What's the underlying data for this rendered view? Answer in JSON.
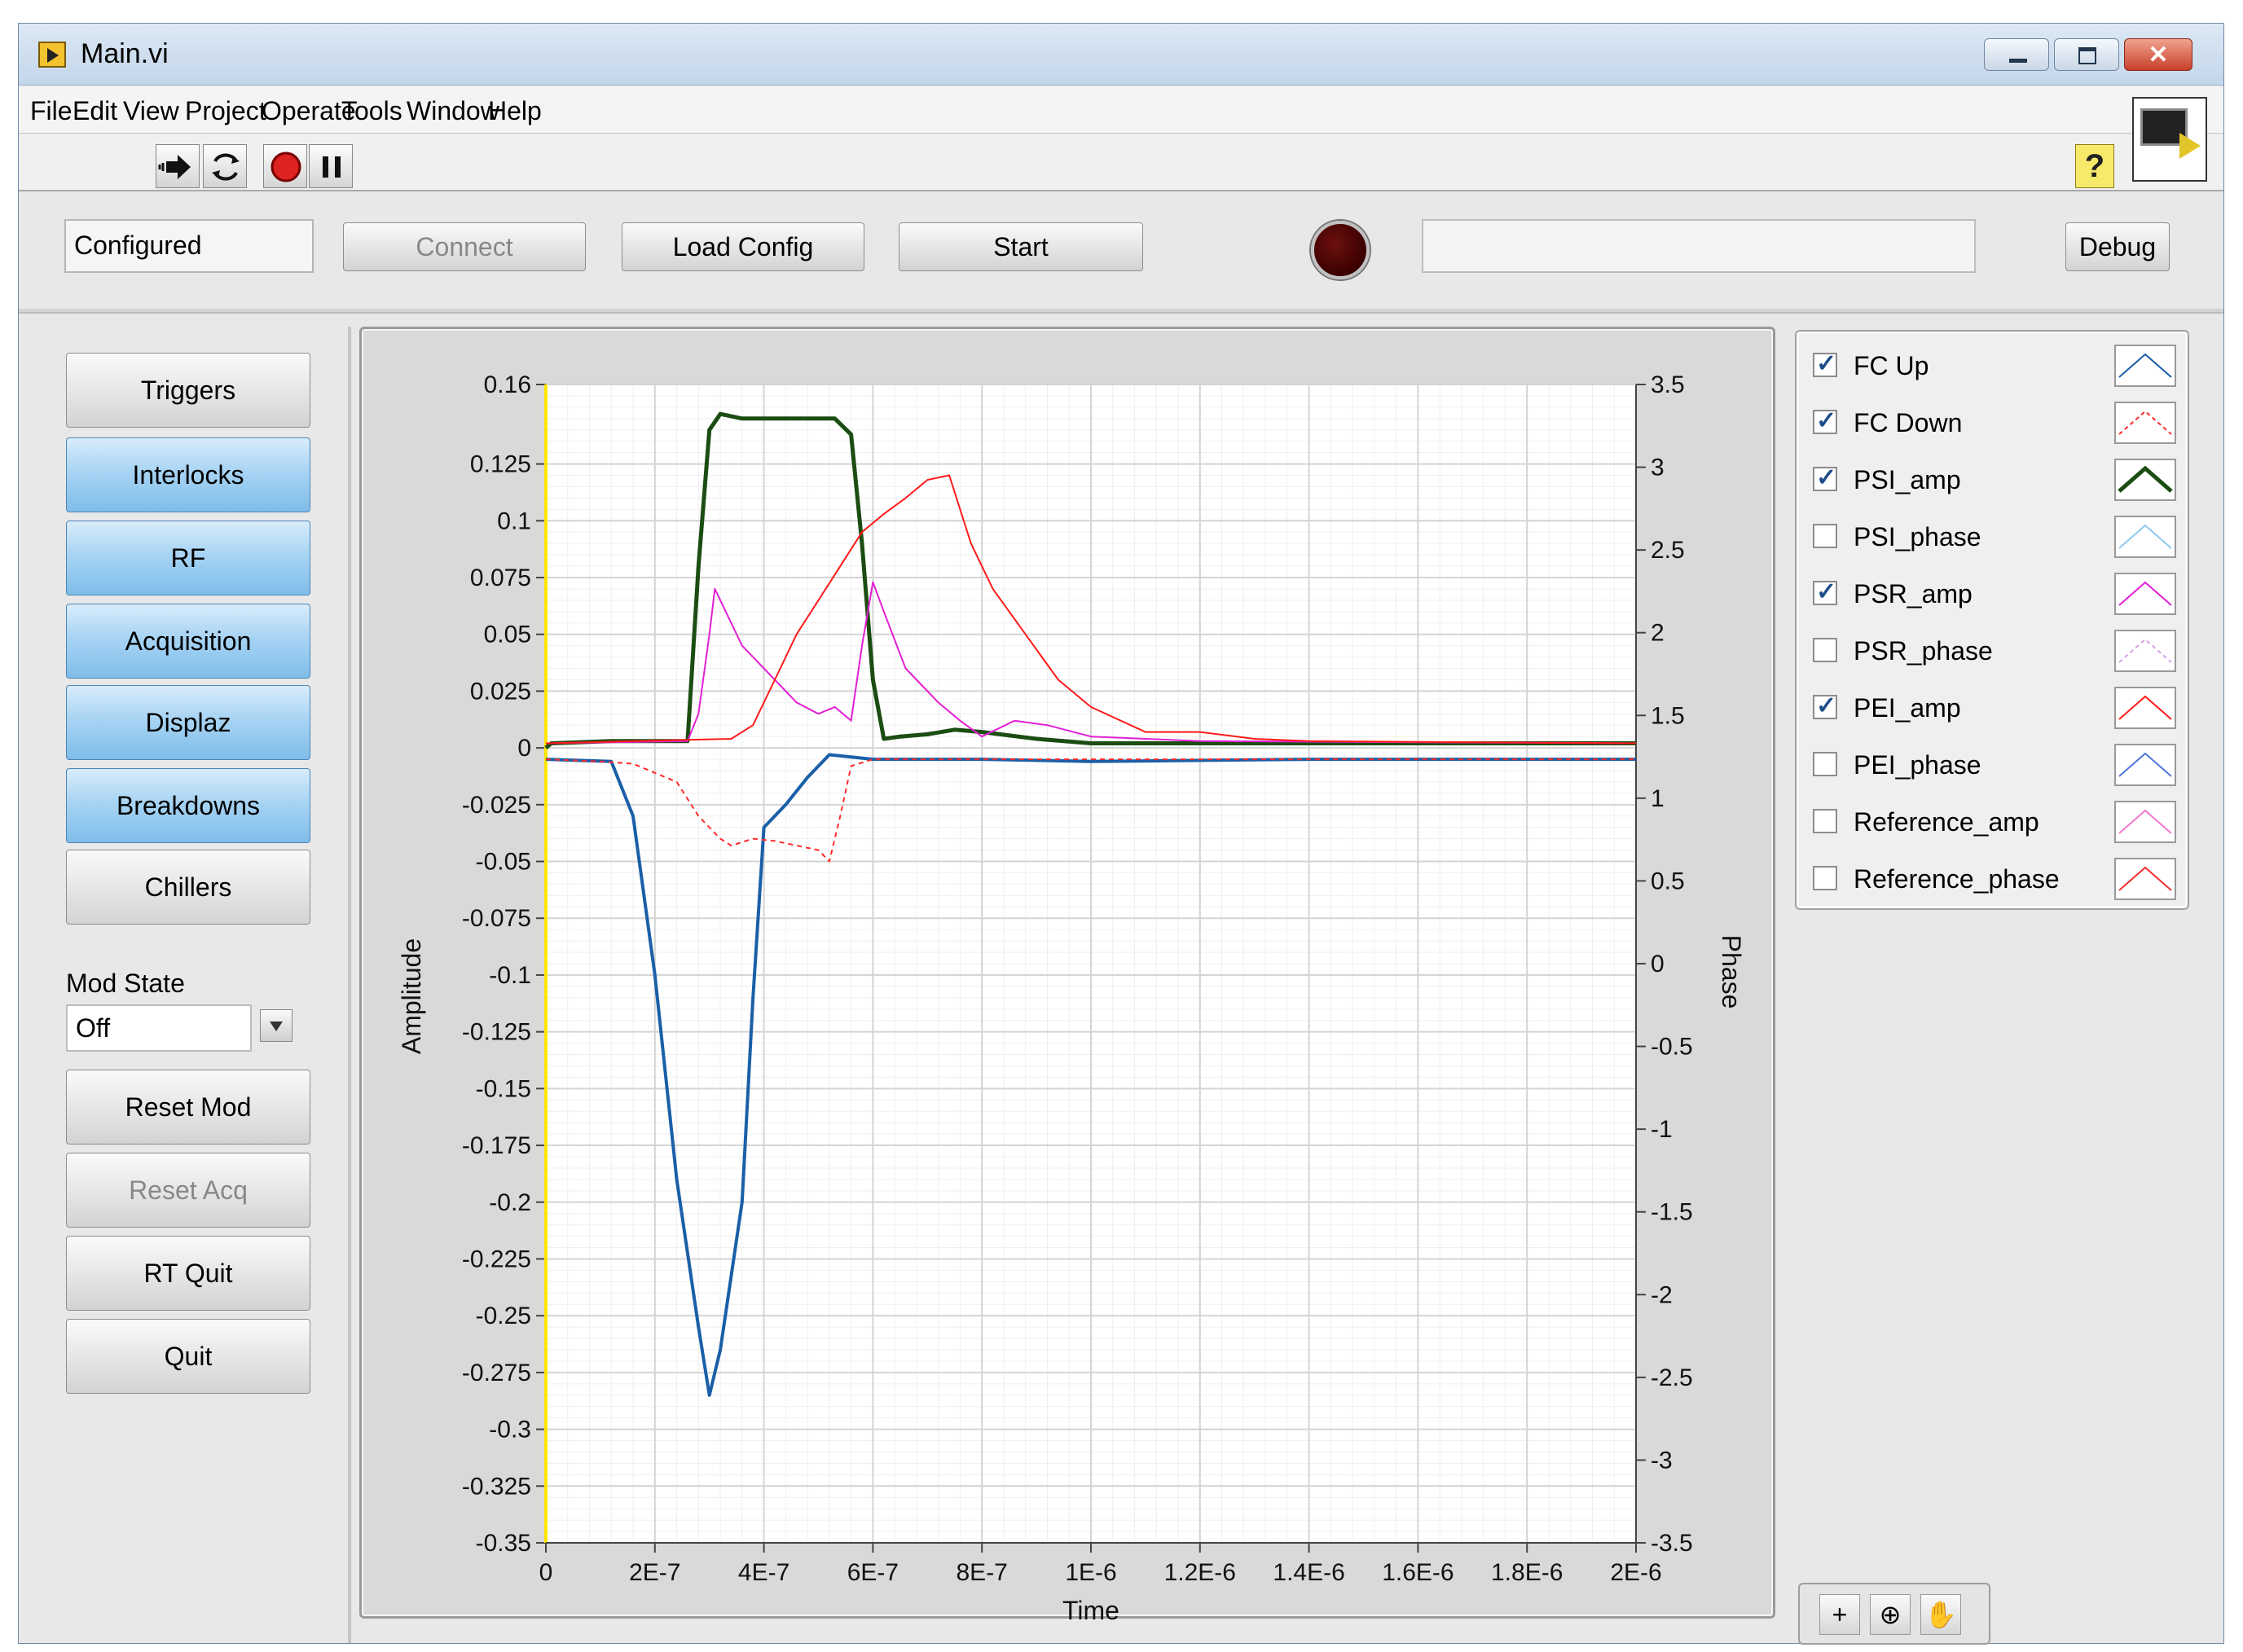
{
  "window": {
    "title": "Main.vi"
  },
  "menubar": {
    "items": [
      "File",
      "Edit",
      "View",
      "Project",
      "Operate",
      "Tools",
      "Window",
      "Help"
    ]
  },
  "toolbar": {
    "run_icon": "run-arrow-icon",
    "run_continuous_icon": "run-continuously-icon",
    "abort_icon": "abort-icon",
    "pause_icon": "pause-icon",
    "help_label": "?"
  },
  "controls": {
    "status_value": "Configured",
    "connect_label": "Connect",
    "load_config_label": "Load Config",
    "start_label": "Start",
    "message_value": "",
    "debug_label": "Debug",
    "led_color": "#3a0000"
  },
  "sidebar": {
    "buttons": [
      {
        "label": "Triggers",
        "style": "gray"
      },
      {
        "label": "Interlocks",
        "style": "blue"
      },
      {
        "label": "RF",
        "style": "blue"
      },
      {
        "label": "Acquisition",
        "style": "blue"
      },
      {
        "label": "Displaz",
        "style": "blue"
      },
      {
        "label": "Breakdowns",
        "style": "blue"
      },
      {
        "label": "Chillers",
        "style": "gray"
      }
    ],
    "mod_state": {
      "label": "Mod State",
      "value": "Off"
    },
    "bottom_buttons": [
      {
        "label": "Reset Mod",
        "disabled": false
      },
      {
        "label": "Reset Acq",
        "disabled": true
      },
      {
        "label": "RT Quit",
        "disabled": false
      },
      {
        "label": "Quit",
        "disabled": false
      }
    ]
  },
  "legend": {
    "items": [
      {
        "name": "FC Up",
        "checked": true,
        "color": "#1a5fa8",
        "dash": false,
        "thick": false
      },
      {
        "name": "FC Down",
        "checked": true,
        "color": "#ff2a2a",
        "dash": true,
        "thick": false
      },
      {
        "name": "PSI_amp",
        "checked": true,
        "color": "#1b4d12",
        "dash": false,
        "thick": true
      },
      {
        "name": "PSI_phase",
        "checked": false,
        "color": "#8fc8ee",
        "dash": false,
        "thick": false
      },
      {
        "name": "PSR_amp",
        "checked": true,
        "color": "#e21fd4",
        "dash": false,
        "thick": false
      },
      {
        "name": "PSR_phase",
        "checked": false,
        "color": "#d6a0e8",
        "dash": true,
        "thick": false
      },
      {
        "name": "PEI_amp",
        "checked": true,
        "color": "#ff1a1a",
        "dash": false,
        "thick": false
      },
      {
        "name": "PEI_phase",
        "checked": false,
        "color": "#4e76d8",
        "dash": false,
        "thick": false
      },
      {
        "name": "Reference_amp",
        "checked": false,
        "color": "#f07ad0",
        "dash": false,
        "thick": false
      },
      {
        "name": "Reference_phase",
        "checked": false,
        "color": "#f03030",
        "dash": false,
        "thick": false
      }
    ]
  },
  "tools": [
    "crosshair-cursor-icon",
    "zoom-icon",
    "pan-hand-icon"
  ],
  "chart_data": {
    "type": "line",
    "title": "",
    "xlabel": "Time",
    "ylabel": "Amplitude",
    "y2label": "Phase",
    "xlim": [
      0,
      2e-06
    ],
    "ylim": [
      -0.35,
      0.16
    ],
    "y2lim": [
      -3.5,
      3.5
    ],
    "x_ticks": [
      "0",
      "2E-7",
      "4E-7",
      "6E-7",
      "8E-7",
      "1E-6",
      "1.2E-6",
      "1.4E-6",
      "1.6E-6",
      "1.8E-6",
      "2E-6"
    ],
    "y_ticks": [
      "0.16",
      "0.125",
      "0.1",
      "0.075",
      "0.05",
      "0.025",
      "0",
      "-0.025",
      "-0.05",
      "-0.075",
      "-0.1",
      "-0.125",
      "-0.15",
      "-0.175",
      "-0.2",
      "-0.225",
      "-0.25",
      "-0.275",
      "-0.3",
      "-0.325",
      "-0.35"
    ],
    "y2_ticks": [
      "3.5",
      "3",
      "2.5",
      "2",
      "1.5",
      "1",
      "0.5",
      "0",
      "-0.5",
      "-1",
      "-1.5",
      "-2",
      "-2.5",
      "-3",
      "-3.5"
    ],
    "grid": true,
    "series": [
      {
        "name": "FC Up",
        "axis": "left",
        "color": "#1a5fa8",
        "width": 4,
        "dash": false,
        "x": [
          0,
          1.2e-07,
          1.6e-07,
          2e-07,
          2.4e-07,
          2.8e-07,
          3e-07,
          3.2e-07,
          3.6e-07,
          3.8e-07,
          4e-07,
          4.4e-07,
          4.8e-07,
          5.2e-07,
          5.6e-07,
          6e-07,
          8e-07,
          1e-06,
          1.4e-06,
          2e-06
        ],
        "y": [
          -0.005,
          -0.006,
          -0.03,
          -0.1,
          -0.19,
          -0.255,
          -0.285,
          -0.265,
          -0.2,
          -0.11,
          -0.035,
          -0.025,
          -0.013,
          -0.003,
          -0.004,
          -0.005,
          -0.005,
          -0.006,
          -0.005,
          -0.005
        ]
      },
      {
        "name": "FC Down",
        "axis": "left",
        "color": "#ff2a2a",
        "width": 2,
        "dash": true,
        "x": [
          0,
          1e-07,
          1.6e-07,
          2.4e-07,
          2.8e-07,
          3.2e-07,
          3.4e-07,
          3.8e-07,
          4.2e-07,
          4.6e-07,
          5e-07,
          5.2e-07,
          5.4e-07,
          5.6e-07,
          6e-07,
          8e-07,
          2e-06
        ],
        "y": [
          -0.005,
          -0.006,
          -0.007,
          -0.015,
          -0.03,
          -0.04,
          -0.043,
          -0.04,
          -0.041,
          -0.043,
          -0.045,
          -0.05,
          -0.03,
          -0.008,
          -0.005,
          -0.005,
          -0.005
        ]
      },
      {
        "name": "PSI_amp",
        "axis": "left",
        "color": "#1b4d12",
        "width": 5,
        "dash": false,
        "x": [
          0,
          1e-08,
          1.2e-07,
          2.6e-07,
          2.8e-07,
          3e-07,
          3.2e-07,
          3.6e-07,
          4e-07,
          4.8e-07,
          5.3e-07,
          5.6e-07,
          5.8e-07,
          6e-07,
          6.2e-07,
          6.5e-07,
          7e-07,
          7.5e-07,
          8e-07,
          9e-07,
          1e-06,
          1.4e-06,
          2e-06
        ],
        "y": [
          0,
          0.002,
          0.003,
          0.003,
          0.08,
          0.14,
          0.147,
          0.145,
          0.145,
          0.145,
          0.145,
          0.138,
          0.09,
          0.03,
          0.004,
          0.005,
          0.006,
          0.008,
          0.007,
          0.004,
          0.002,
          0.002,
          0.002
        ]
      },
      {
        "name": "PSR_amp",
        "axis": "left",
        "color": "#e21fd4",
        "width": 2,
        "dash": false,
        "x": [
          0,
          2.6e-07,
          2.8e-07,
          3e-07,
          3.1e-07,
          3.3e-07,
          3.6e-07,
          4.2e-07,
          4.6e-07,
          5e-07,
          5.3e-07,
          5.6e-07,
          5.8e-07,
          6e-07,
          6.2e-07,
          6.6e-07,
          7.2e-07,
          7.6e-07,
          8e-07,
          8.6e-07,
          9.2e-07,
          1e-06,
          1.2e-06,
          2e-06
        ],
        "y": [
          0.002,
          0.003,
          0.015,
          0.05,
          0.07,
          0.06,
          0.045,
          0.03,
          0.02,
          0.015,
          0.018,
          0.012,
          0.045,
          0.073,
          0.06,
          0.035,
          0.02,
          0.012,
          0.005,
          0.012,
          0.01,
          0.005,
          0.003,
          0.002
        ]
      },
      {
        "name": "PEI_amp",
        "axis": "left",
        "color": "#ff1a1a",
        "width": 2,
        "dash": false,
        "x": [
          0,
          3.4e-07,
          3.8e-07,
          4.2e-07,
          4.6e-07,
          5e-07,
          5.4e-07,
          5.8e-07,
          6.2e-07,
          6.6e-07,
          7e-07,
          7.4e-07,
          7.8e-07,
          8.2e-07,
          8.8e-07,
          9.4e-07,
          1e-06,
          1.1e-06,
          1.2e-06,
          1.3e-06,
          1.4e-06,
          2e-06
        ],
        "y": [
          0.002,
          0.004,
          0.01,
          0.03,
          0.05,
          0.065,
          0.08,
          0.095,
          0.103,
          0.11,
          0.118,
          0.12,
          0.09,
          0.07,
          0.05,
          0.03,
          0.018,
          0.007,
          0.007,
          0.004,
          0.003,
          0.002
        ]
      }
    ]
  }
}
